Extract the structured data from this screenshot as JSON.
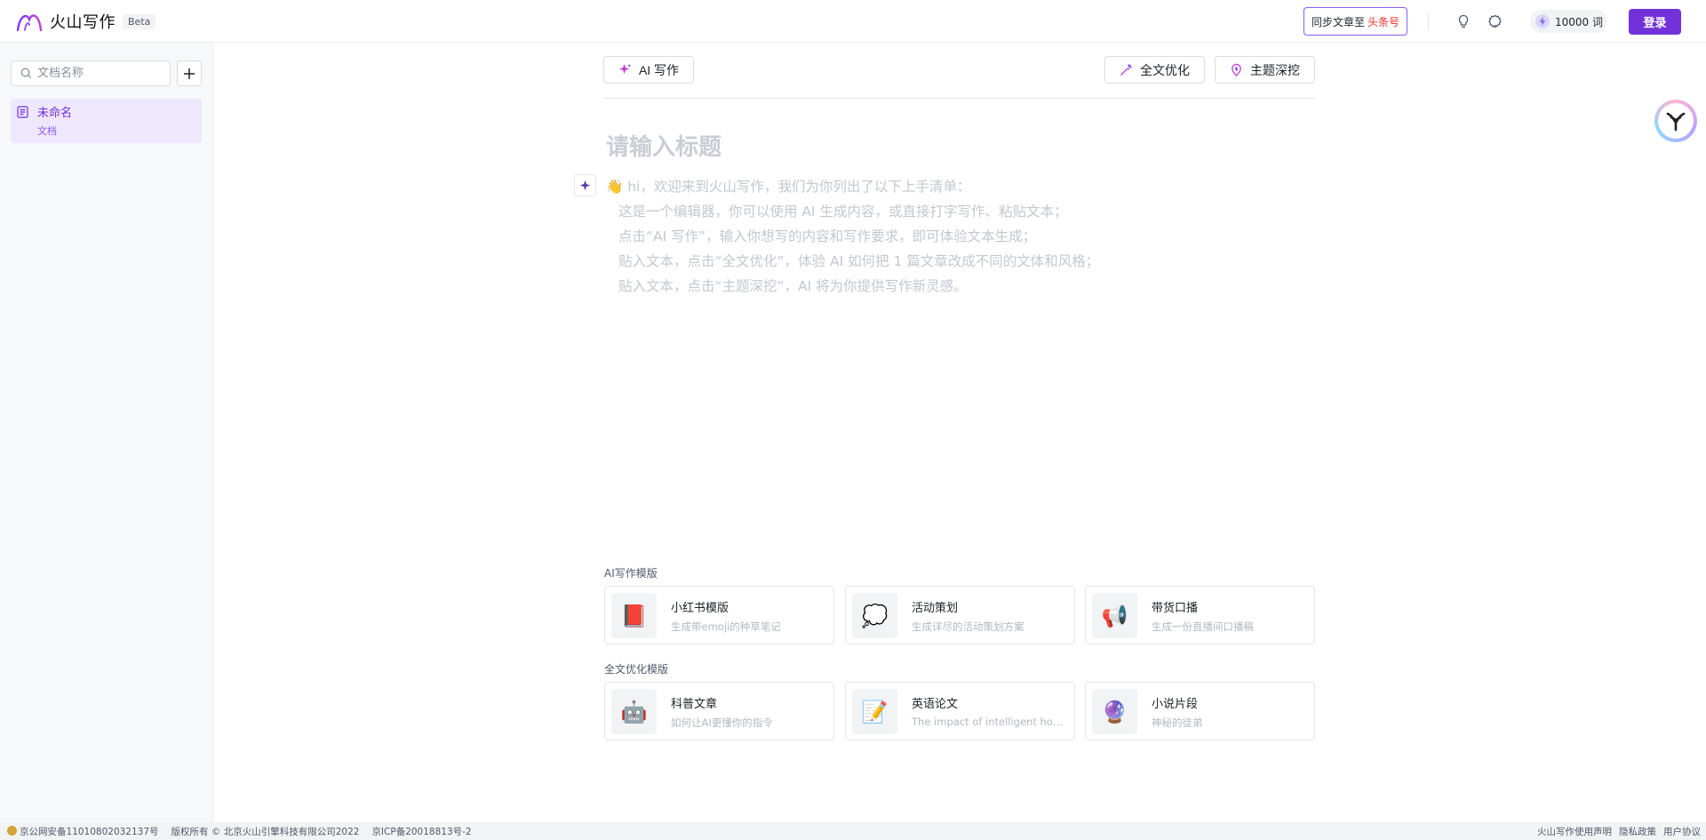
{
  "header": {
    "logo_text": "火山写作",
    "beta_label": "Beta",
    "sync_label": "同步文章至",
    "sync_brand": "头条号",
    "credits_value": "10000 词",
    "login_label": "登录",
    "icons": [
      "lightbulb-icon",
      "settings-icon",
      "bolt-icon"
    ]
  },
  "sidebar": {
    "search_placeholder": "文档名称",
    "documents": [
      {
        "title": "未命名",
        "subtitle": "文档"
      }
    ]
  },
  "editor": {
    "ai_write_label": "AI 写作",
    "optimize_label": "全文优化",
    "deep_topic_label": "主题深挖",
    "title_placeholder": "请输入标题",
    "intro_lines": [
      "👋 hi，欢迎来到火山写作，我们为你列出了以下上手清单：",
      "这是一个编辑器，你可以使用 AI 生成内容，或直接打字写作、粘贴文本；",
      "点击“AI 写作”，输入你想写的内容和写作要求，即可体验文本生成；",
      "贴入文本，点击“全文优化”，体验 AI 如何把 1 篇文章改成不同的文体和风格；",
      "贴入文本，点击“主题深挖”，AI 将为你提供写作新灵感。"
    ]
  },
  "templates": {
    "ai_section_label": "AI写作模版",
    "ai_cards": [
      {
        "icon": "📕",
        "title": "小红书模版",
        "desc": "生成带emoji的种草笔记"
      },
      {
        "icon": "💭",
        "title": "活动策划",
        "desc": "生成详尽的活动策划方案"
      },
      {
        "icon": "📢",
        "title": "带货口播",
        "desc": "生成一份直播间口播稿"
      }
    ],
    "opt_section_label": "全文优化模版",
    "opt_cards": [
      {
        "icon": "🤖",
        "title": "科普文章",
        "desc": "如何让AI更懂你的指令"
      },
      {
        "icon": "📝",
        "title": "英语论文",
        "desc": "The impact of intelligent hou…"
      },
      {
        "icon": "🔮",
        "title": "小说片段",
        "desc": "神秘的徒弟"
      }
    ]
  },
  "footer": {
    "police_record": "京公网安备11010802032137号",
    "copyright": "版权所有 © 北京火山引擎科技有限公司2022",
    "icp": "京ICP备20018813号-2",
    "links": [
      "火山写作使用声明",
      "隐私政策",
      "用户协议"
    ]
  },
  "colors": {
    "accent": "#7231d9",
    "accent_light": "#efe7fd",
    "sync_brand": "#e9302d"
  }
}
